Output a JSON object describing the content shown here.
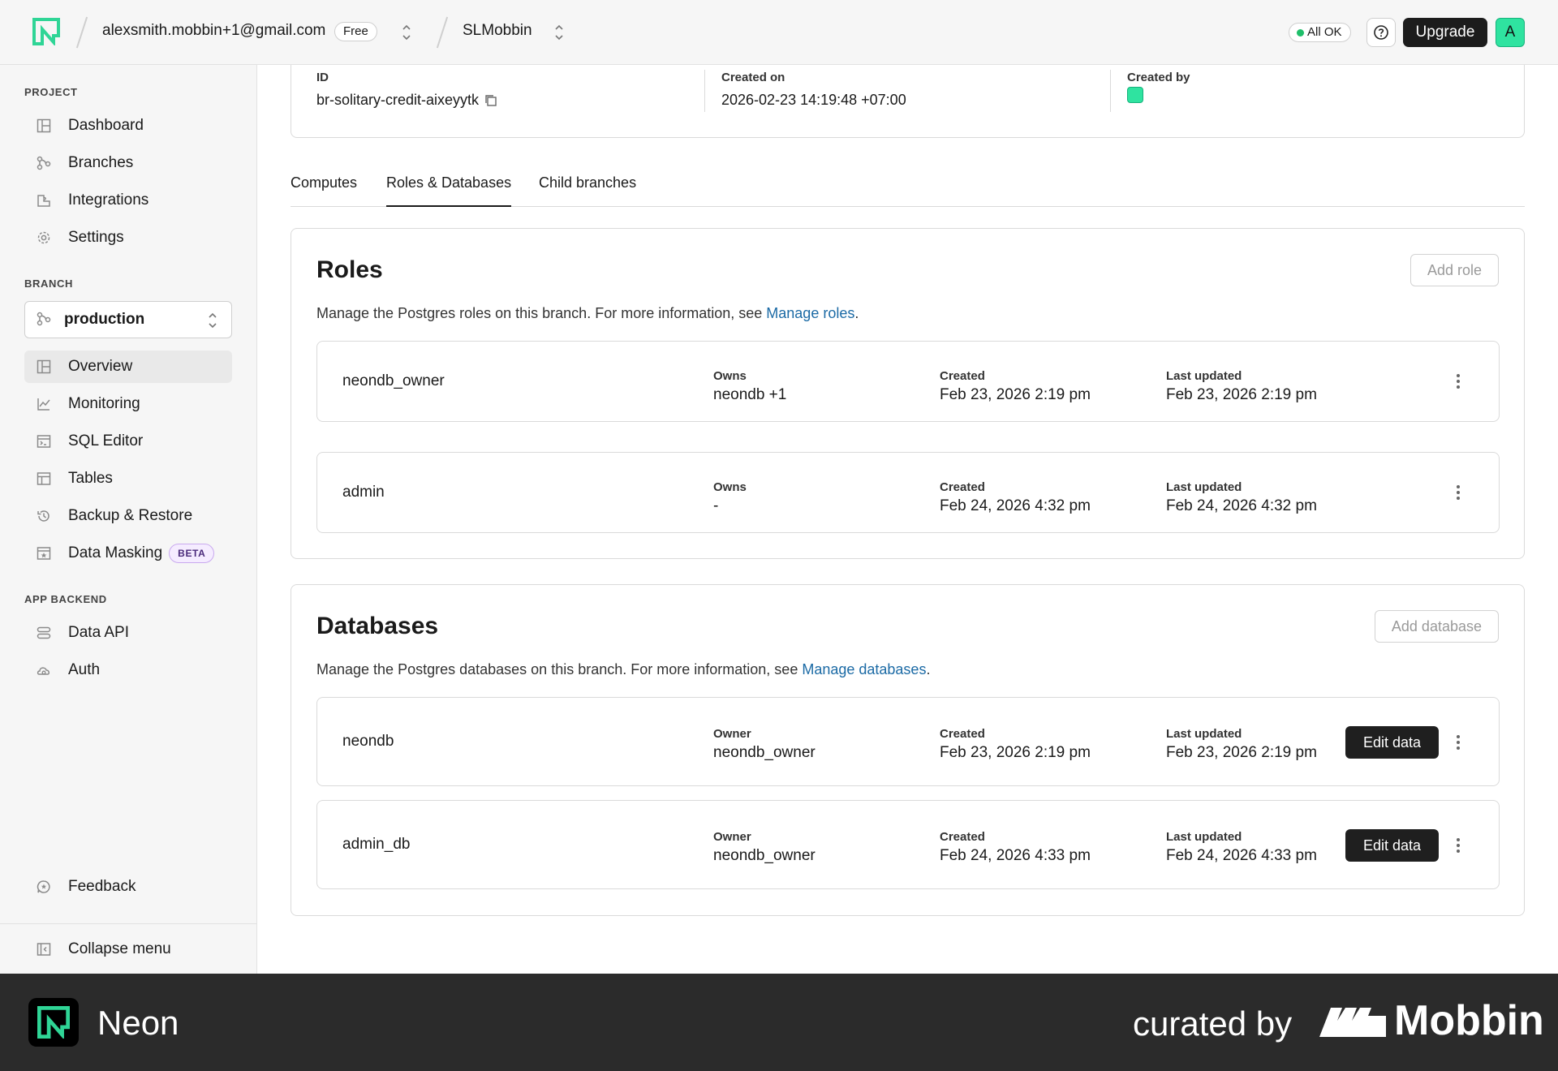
{
  "topbar": {
    "account_email": "alexsmith.mobbin+1@gmail.com",
    "plan": "Free",
    "project": "SLMobbin",
    "status": "All OK",
    "upgrade_label": "Upgrade",
    "avatar_initial": "A"
  },
  "sidebar": {
    "project_label": "PROJECT",
    "project_items": [
      {
        "label": "Dashboard",
        "icon": "dashboard-icon"
      },
      {
        "label": "Branches",
        "icon": "branches-icon"
      },
      {
        "label": "Integrations",
        "icon": "integrations-icon"
      },
      {
        "label": "Settings",
        "icon": "gear-icon"
      }
    ],
    "branch_label": "BRANCH",
    "branch_selected": "production",
    "branch_items": [
      {
        "label": "Overview",
        "icon": "overview-icon",
        "active": true
      },
      {
        "label": "Monitoring",
        "icon": "monitoring-icon"
      },
      {
        "label": "SQL Editor",
        "icon": "sql-editor-icon"
      },
      {
        "label": "Tables",
        "icon": "tables-icon"
      },
      {
        "label": "Backup & Restore",
        "icon": "history-icon"
      },
      {
        "label": "Data Masking",
        "icon": "data-masking-icon",
        "badge": "BETA"
      }
    ],
    "app_backend_label": "APP BACKEND",
    "app_items": [
      {
        "label": "Data API",
        "icon": "data-api-icon"
      },
      {
        "label": "Auth",
        "icon": "auth-icon"
      }
    ],
    "feedback_label": "Feedback",
    "collapse_label": "Collapse menu"
  },
  "branch_info": {
    "id_label": "ID",
    "id_value": "br-solitary-credit-aixeyytk",
    "created_on_label": "Created on",
    "created_on_value": "2026-02-23 14:19:48 +07:00",
    "created_by_label": "Created by"
  },
  "tabs": [
    "Computes",
    "Roles & Databases",
    "Child branches"
  ],
  "roles": {
    "title": "Roles",
    "add_label": "Add role",
    "desc_prefix": "Manage the Postgres roles on this branch. For more information, see ",
    "desc_link": "Manage roles",
    "desc_suffix": ".",
    "col_owns": "Owns",
    "col_created": "Created",
    "col_updated": "Last updated",
    "rows": [
      {
        "name": "neondb_owner",
        "owns": "neondb +1",
        "created": "Feb 23, 2026 2:19 pm",
        "updated": "Feb 23, 2026 2:19 pm"
      },
      {
        "name": "admin",
        "owns": "-",
        "created": "Feb 24, 2026 4:32 pm",
        "updated": "Feb 24, 2026 4:32 pm"
      }
    ]
  },
  "databases": {
    "title": "Databases",
    "add_label": "Add database",
    "desc_prefix": "Manage the Postgres databases on this branch. For more information, see ",
    "desc_link": "Manage databases",
    "desc_suffix": ".",
    "col_owner": "Owner",
    "col_created": "Created",
    "col_updated": "Last updated",
    "edit_label": "Edit data",
    "rows": [
      {
        "name": "neondb",
        "owner": "neondb_owner",
        "created": "Feb 23, 2026 2:19 pm",
        "updated": "Feb 23, 2026 2:19 pm"
      },
      {
        "name": "admin_db",
        "owner": "neondb_owner",
        "created": "Feb 24, 2026 4:33 pm",
        "updated": "Feb 24, 2026 4:33 pm"
      }
    ]
  },
  "footer": {
    "brand": "Neon",
    "curated": "curated by",
    "curator": "Mobbin"
  },
  "colors": {
    "accent_green": "#2fe3a0",
    "link_blue": "#1b6aa5",
    "dark_button": "#1f1f1f",
    "status_green": "#1fbf6a"
  }
}
